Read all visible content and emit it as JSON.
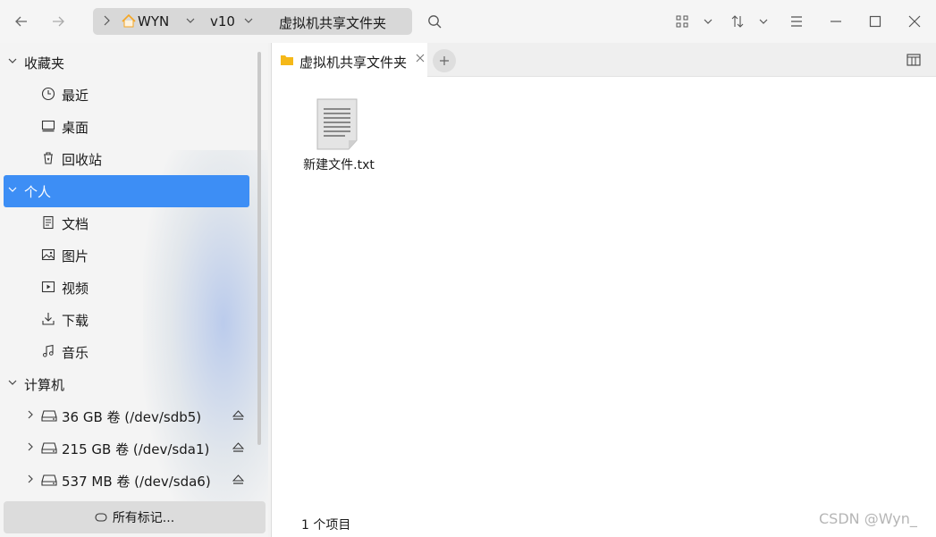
{
  "toolbar": {
    "breadcrumbs": [
      {
        "label": "WYN",
        "icon": "home-icon"
      },
      {
        "label": "v10"
      },
      {
        "label": "虚拟机共享文件夹"
      }
    ]
  },
  "sidebar": {
    "groups": [
      {
        "label": "收藏夹",
        "items": [
          {
            "label": "最近",
            "icon": "clock-icon"
          },
          {
            "label": "桌面",
            "icon": "desktop-icon"
          },
          {
            "label": "回收站",
            "icon": "trash-icon"
          }
        ]
      },
      {
        "label": "个人",
        "selected": true,
        "items": [
          {
            "label": "文档",
            "icon": "document-icon"
          },
          {
            "label": "图片",
            "icon": "image-icon"
          },
          {
            "label": "视频",
            "icon": "video-icon"
          },
          {
            "label": "下载",
            "icon": "download-icon"
          },
          {
            "label": "音乐",
            "icon": "music-icon"
          }
        ]
      },
      {
        "label": "计算机",
        "items": [
          {
            "label": "36 GB 卷 (/dev/sdb5)",
            "icon": "drive-icon"
          },
          {
            "label": "215 GB 卷 (/dev/sda1)",
            "icon": "drive-icon"
          },
          {
            "label": "537 MB 卷 (/dev/sda6)",
            "icon": "drive-icon"
          }
        ]
      }
    ],
    "tags_button": "所有标记..."
  },
  "tabs": [
    {
      "label": "虚拟机共享文件夹",
      "icon": "folder-icon"
    }
  ],
  "files": [
    {
      "name": "新建文件.txt",
      "icon": "text-file-icon"
    }
  ],
  "status": {
    "count": "1 个项目"
  },
  "watermark": "CSDN @Wyn_",
  "colors": {
    "accent": "#3d8ef5",
    "folder": "#f5b818",
    "home": "#f5a623"
  }
}
